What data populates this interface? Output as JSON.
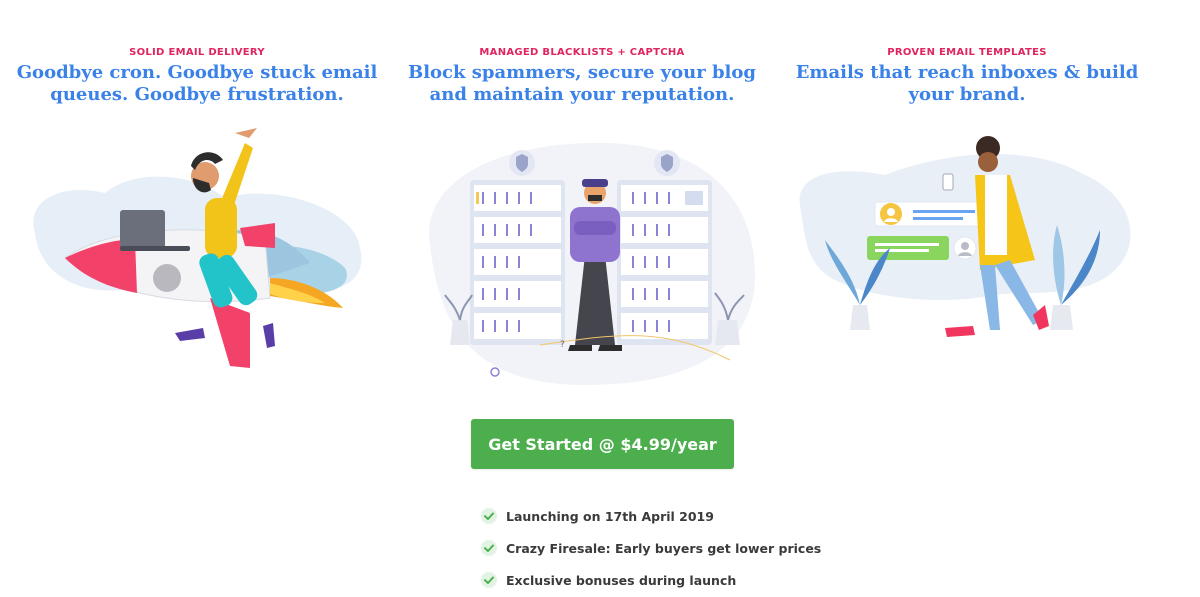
{
  "features": [
    {
      "kicker": "SOLID EMAIL DELIVERY",
      "heading_line1": "Goodbye cron. Goodbye stuck email",
      "heading_line2": "queues. Goodbye frustration.",
      "illustration": "rocket-rider-illustration"
    },
    {
      "kicker": "MANAGED BLACKLISTS + CAPTCHA",
      "heading_line1": "Block spammers, secure your blog",
      "heading_line2": "and maintain your reputation.",
      "illustration": "security-guard-servers-illustration"
    },
    {
      "kicker": "PROVEN EMAIL TEMPLATES",
      "heading_line1": "Emails that reach inboxes & build",
      "heading_line2": "your brand.",
      "illustration": "woman-with-phone-messages-illustration"
    }
  ],
  "cta": {
    "label": "Get Started @ $4.99/year"
  },
  "benefits": [
    {
      "icon": "check-icon",
      "text": "Launching on 17th April 2019"
    },
    {
      "icon": "check-icon",
      "text": "Crazy Firesale: Early buyers get lower prices"
    },
    {
      "icon": "check-icon",
      "text": "Exclusive bonuses during launch"
    }
  ],
  "colors": {
    "kicker": "#e0245e",
    "heading": "#3b82e8",
    "cta_bg": "#4cae4c",
    "check": "#4cae4c",
    "check_bg": "#e3f3e3"
  }
}
